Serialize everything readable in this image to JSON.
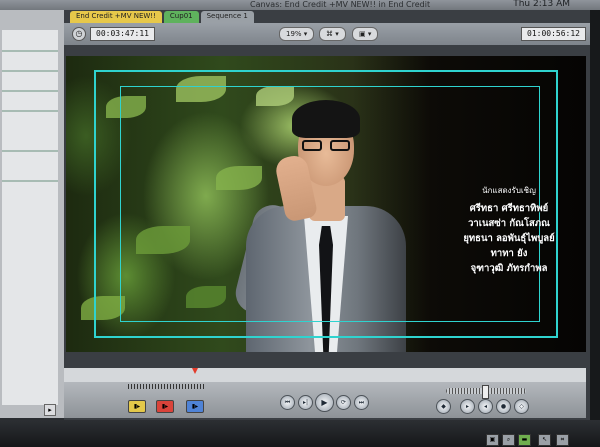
{
  "window": {
    "title": "Canvas: End Credit +MV NEW!! in End Credit",
    "clock": "Thu 2:13 AM"
  },
  "tabs": [
    {
      "label": "End Credit +MV NEW!!"
    },
    {
      "label": "Cup01"
    },
    {
      "label": "Sequence 1"
    }
  ],
  "toolbar": {
    "timecode_current": "00:03:47:11",
    "zoom": "19%",
    "timecode_duration": "01:00:56:12"
  },
  "credits": {
    "heading": "นักแสดงรับเชิญ",
    "names": [
      "ศรีทธา ศรีทธาทิพย์",
      "วาเนสซ่า กัณโสภณ",
      "ยุทธนา ลอพันธุ์ไพบูลย์",
      "ทาทา ยัง",
      "จุฑาวุฒิ ภัทรกำพล"
    ]
  },
  "icons": {
    "play": "play-icon",
    "prev": "previous-edit-icon",
    "next": "next-edit-icon",
    "loop": "loop-icon"
  },
  "colors": {
    "safe_area": "#2fd3cf",
    "tab_active": "#e7c84a",
    "tab_clip": "#5fb25d",
    "playhead": "#e23b2b"
  }
}
